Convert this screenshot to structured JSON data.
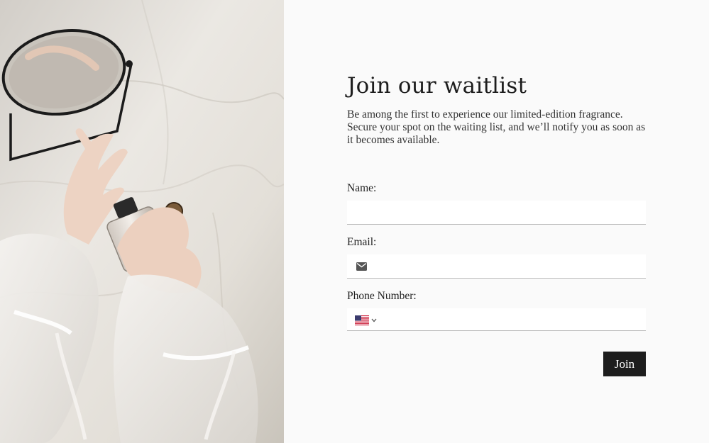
{
  "colors": {
    "background": "#fafafa",
    "text": "#1d1d1d",
    "button_bg": "#1d1d1d",
    "button_text": "#ffffff",
    "input_bg": "#ffffff",
    "input_border": "#b9b9b9"
  },
  "hero_image": {
    "icon": "perfume-photo"
  },
  "form": {
    "title": "Join our waitlist",
    "description": "Be among the first to experience our limited-edition fragrance. Secure your spot on the waiting list, and we’ll notify you as soon as it becomes available.",
    "name": {
      "label": "Name:",
      "value": ""
    },
    "email": {
      "label": "Email:",
      "value": "",
      "icon": "envelope-icon"
    },
    "phone": {
      "label": "Phone Number:",
      "value": "",
      "country_icon": "us-flag-icon",
      "dropdown_icon": "chevron-down-icon"
    },
    "submit_label": "Join"
  }
}
